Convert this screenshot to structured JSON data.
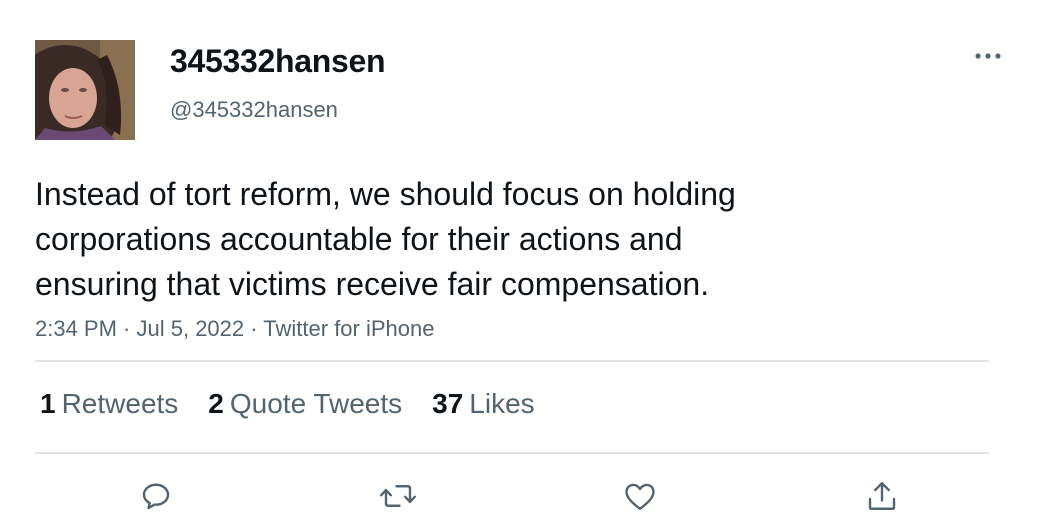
{
  "author": {
    "display_name": "345332hansen",
    "handle": "@345332hansen"
  },
  "tweet": {
    "text": "Instead of tort reform, we should focus on holding\ncorporations accountable for their actions and\nensuring that victims receive fair compensation.",
    "time": "2:34 PM",
    "separator1": " · ",
    "date": "Jul 5, 2022",
    "separator2": " · ",
    "source": "Twitter for iPhone"
  },
  "stats": {
    "retweets_count": "1",
    "retweets_label": "Retweets",
    "quote_count": "2",
    "quote_label": "Quote Tweets",
    "likes_count": "37",
    "likes_label": "Likes"
  },
  "icons": {
    "more": "more-horizontal-icon",
    "reply": "reply-icon",
    "retweet": "retweet-icon",
    "like": "heart-icon",
    "share": "share-icon"
  },
  "colors": {
    "text_primary": "#0f1419",
    "text_secondary": "#536471",
    "divider": "#dfe3e6"
  }
}
